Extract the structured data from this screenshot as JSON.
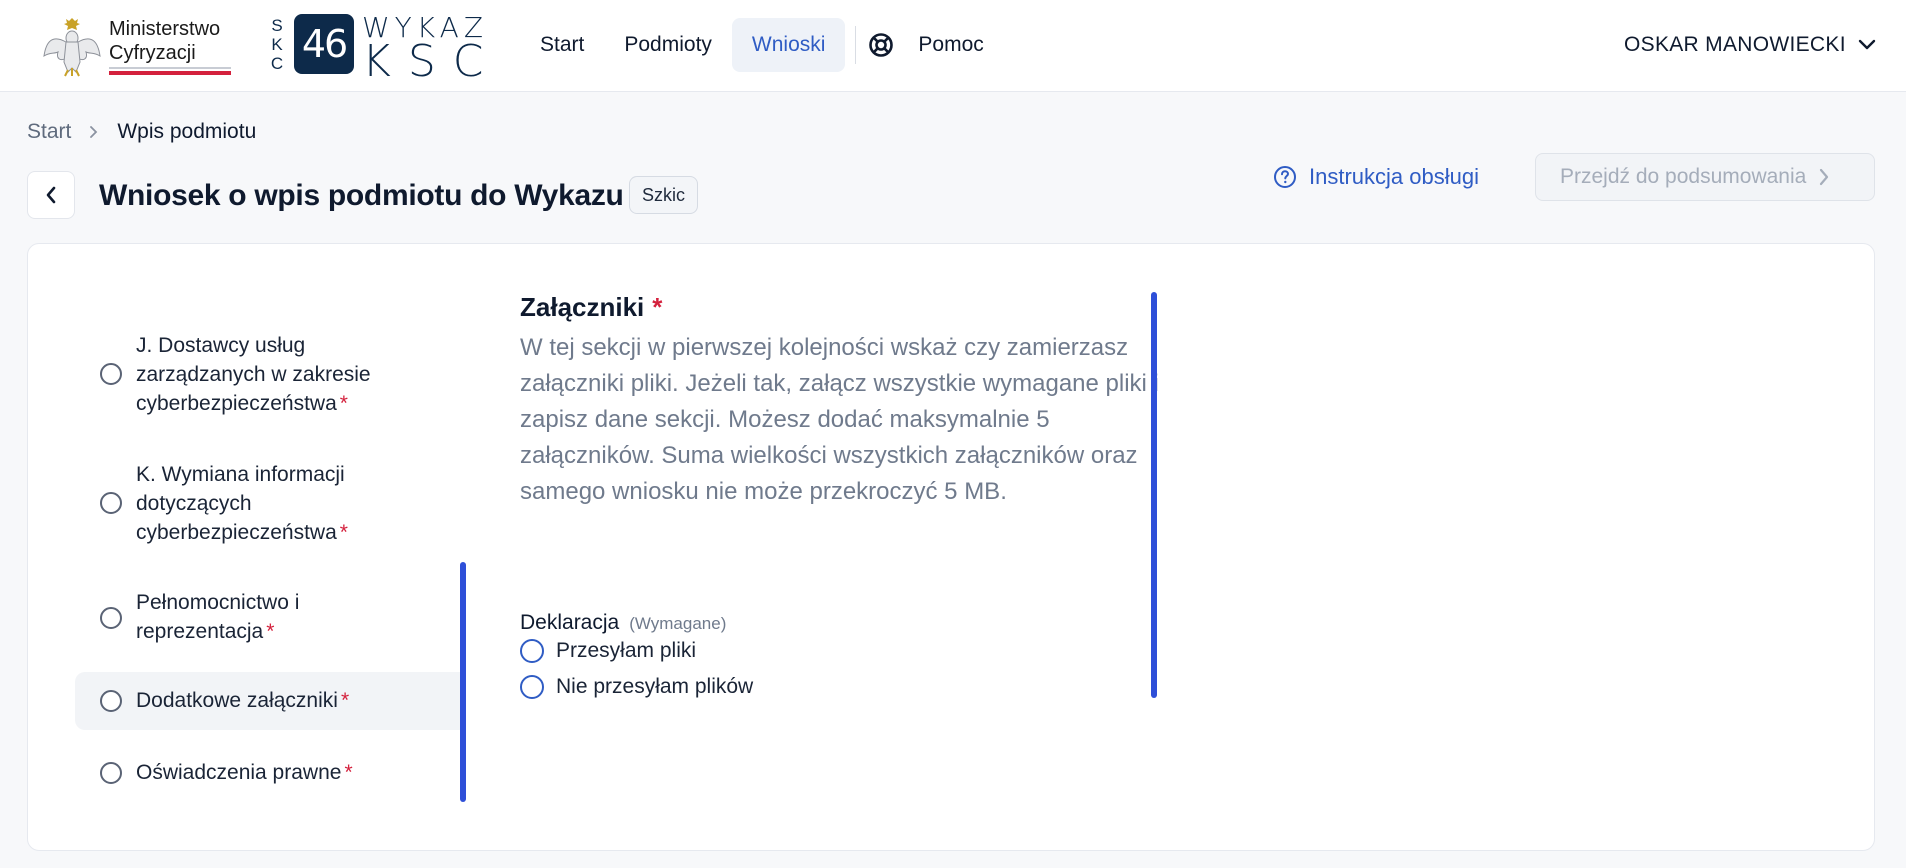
{
  "header": {
    "ministry_name_line1": "Ministerstwo",
    "ministry_name_line2": "Cyfryzacji",
    "ksc_vertical": [
      "S",
      "K",
      "C"
    ],
    "ksc_number": "46",
    "ksc_top": "WYKAZ",
    "ksc_bottom": "KSC",
    "nav": [
      {
        "label": "Start",
        "active": false
      },
      {
        "label": "Podmioty",
        "active": false
      },
      {
        "label": "Wnioski",
        "active": true
      }
    ],
    "help_label": "Pomoc",
    "user_name": "OSKAR MANOWIECKI"
  },
  "breadcrumb": {
    "home": "Start",
    "current": "Wpis podmiotu"
  },
  "page": {
    "title": "Wniosek o wpis podmiotu do Wykazu",
    "status": "Szkic",
    "manual_link": "Instrukcja obsługi",
    "summary_button": "Przejdź do podsumowania"
  },
  "steps": [
    {
      "label": "J. Dostawcy usług zarządzanych w zakresie cyberbezpieczeństwa",
      "required": "*",
      "active": false
    },
    {
      "label": "K. Wymiana informacji dotyczących cyberbezpieczeństwa",
      "required": "*",
      "active": false
    },
    {
      "label": "Pełnomocnictwo i reprezentacja",
      "required": "*",
      "active": false
    },
    {
      "label": "Dodatkowe załączniki",
      "required": "*",
      "active": true
    },
    {
      "label": "Oświadczenia prawne",
      "required": "*",
      "active": false
    }
  ],
  "section": {
    "title": "Załączniki",
    "required": "*",
    "description": "W tej sekcji w pierwszej kolejności wskaż czy zamierzasz załączniki pliki. Jeżeli tak, załącz wszystkie wymagane pliki i zapisz dane sekcji. Możesz dodać maksymalnie 5 załączników. Suma wielkości wszystkich załączników oraz samego wniosku nie może przekroczyć 5 MB.",
    "declaration_label": "Deklaracja",
    "declaration_required": "(Wymagane)",
    "options": [
      "Przesyłam pliki",
      "Nie przesyłam plików"
    ]
  },
  "colors": {
    "accent": "#2f5cc4",
    "required": "#d4213d",
    "scrollbar": "#2e4fd8",
    "brand_navy": "#0d2a4a"
  },
  "icons": {
    "help": "lifebuoy-icon",
    "user_menu": "chevron-down-icon",
    "back": "chevron-left-icon",
    "manual": "question-circle-icon",
    "summary": "chevron-right-icon"
  }
}
